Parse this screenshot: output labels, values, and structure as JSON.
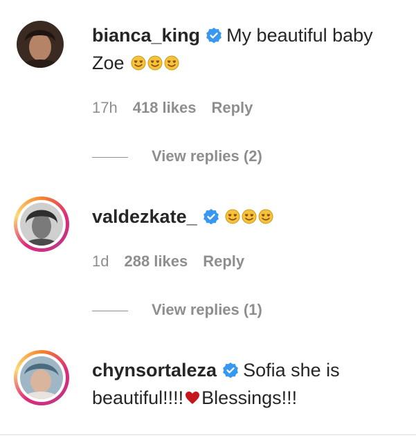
{
  "comments": [
    {
      "username": "bianca_king",
      "verified": true,
      "text_line1": "My beautiful baby",
      "text_line2": "Zoe",
      "emoji_count": 3,
      "time": "17h",
      "likes": "418 likes",
      "reply": "Reply",
      "view_replies": "View replies (2)",
      "avatar_story_ring": false
    },
    {
      "username": "valdezkate_",
      "verified": true,
      "emoji_count": 3,
      "time": "1d",
      "likes": "288 likes",
      "reply": "Reply",
      "view_replies": "View replies (1)",
      "avatar_story_ring": true
    },
    {
      "username": "chynsortaleza",
      "verified": true,
      "text_line1": "Sofia she is",
      "text_line2a": "beautiful!!!!",
      "text_line2b": "Blessings!!!",
      "avatar_story_ring": true
    }
  ],
  "icons": {
    "verified": "verified-badge-icon",
    "emoji": "smiling-face-with-heart-eyes-emoji",
    "heart": "red-heart-emoji"
  },
  "colors": {
    "text": "#262626",
    "secondary": "#8e8e8e",
    "verified_blue": "#3897f0",
    "heart_red": "#c4161c"
  }
}
